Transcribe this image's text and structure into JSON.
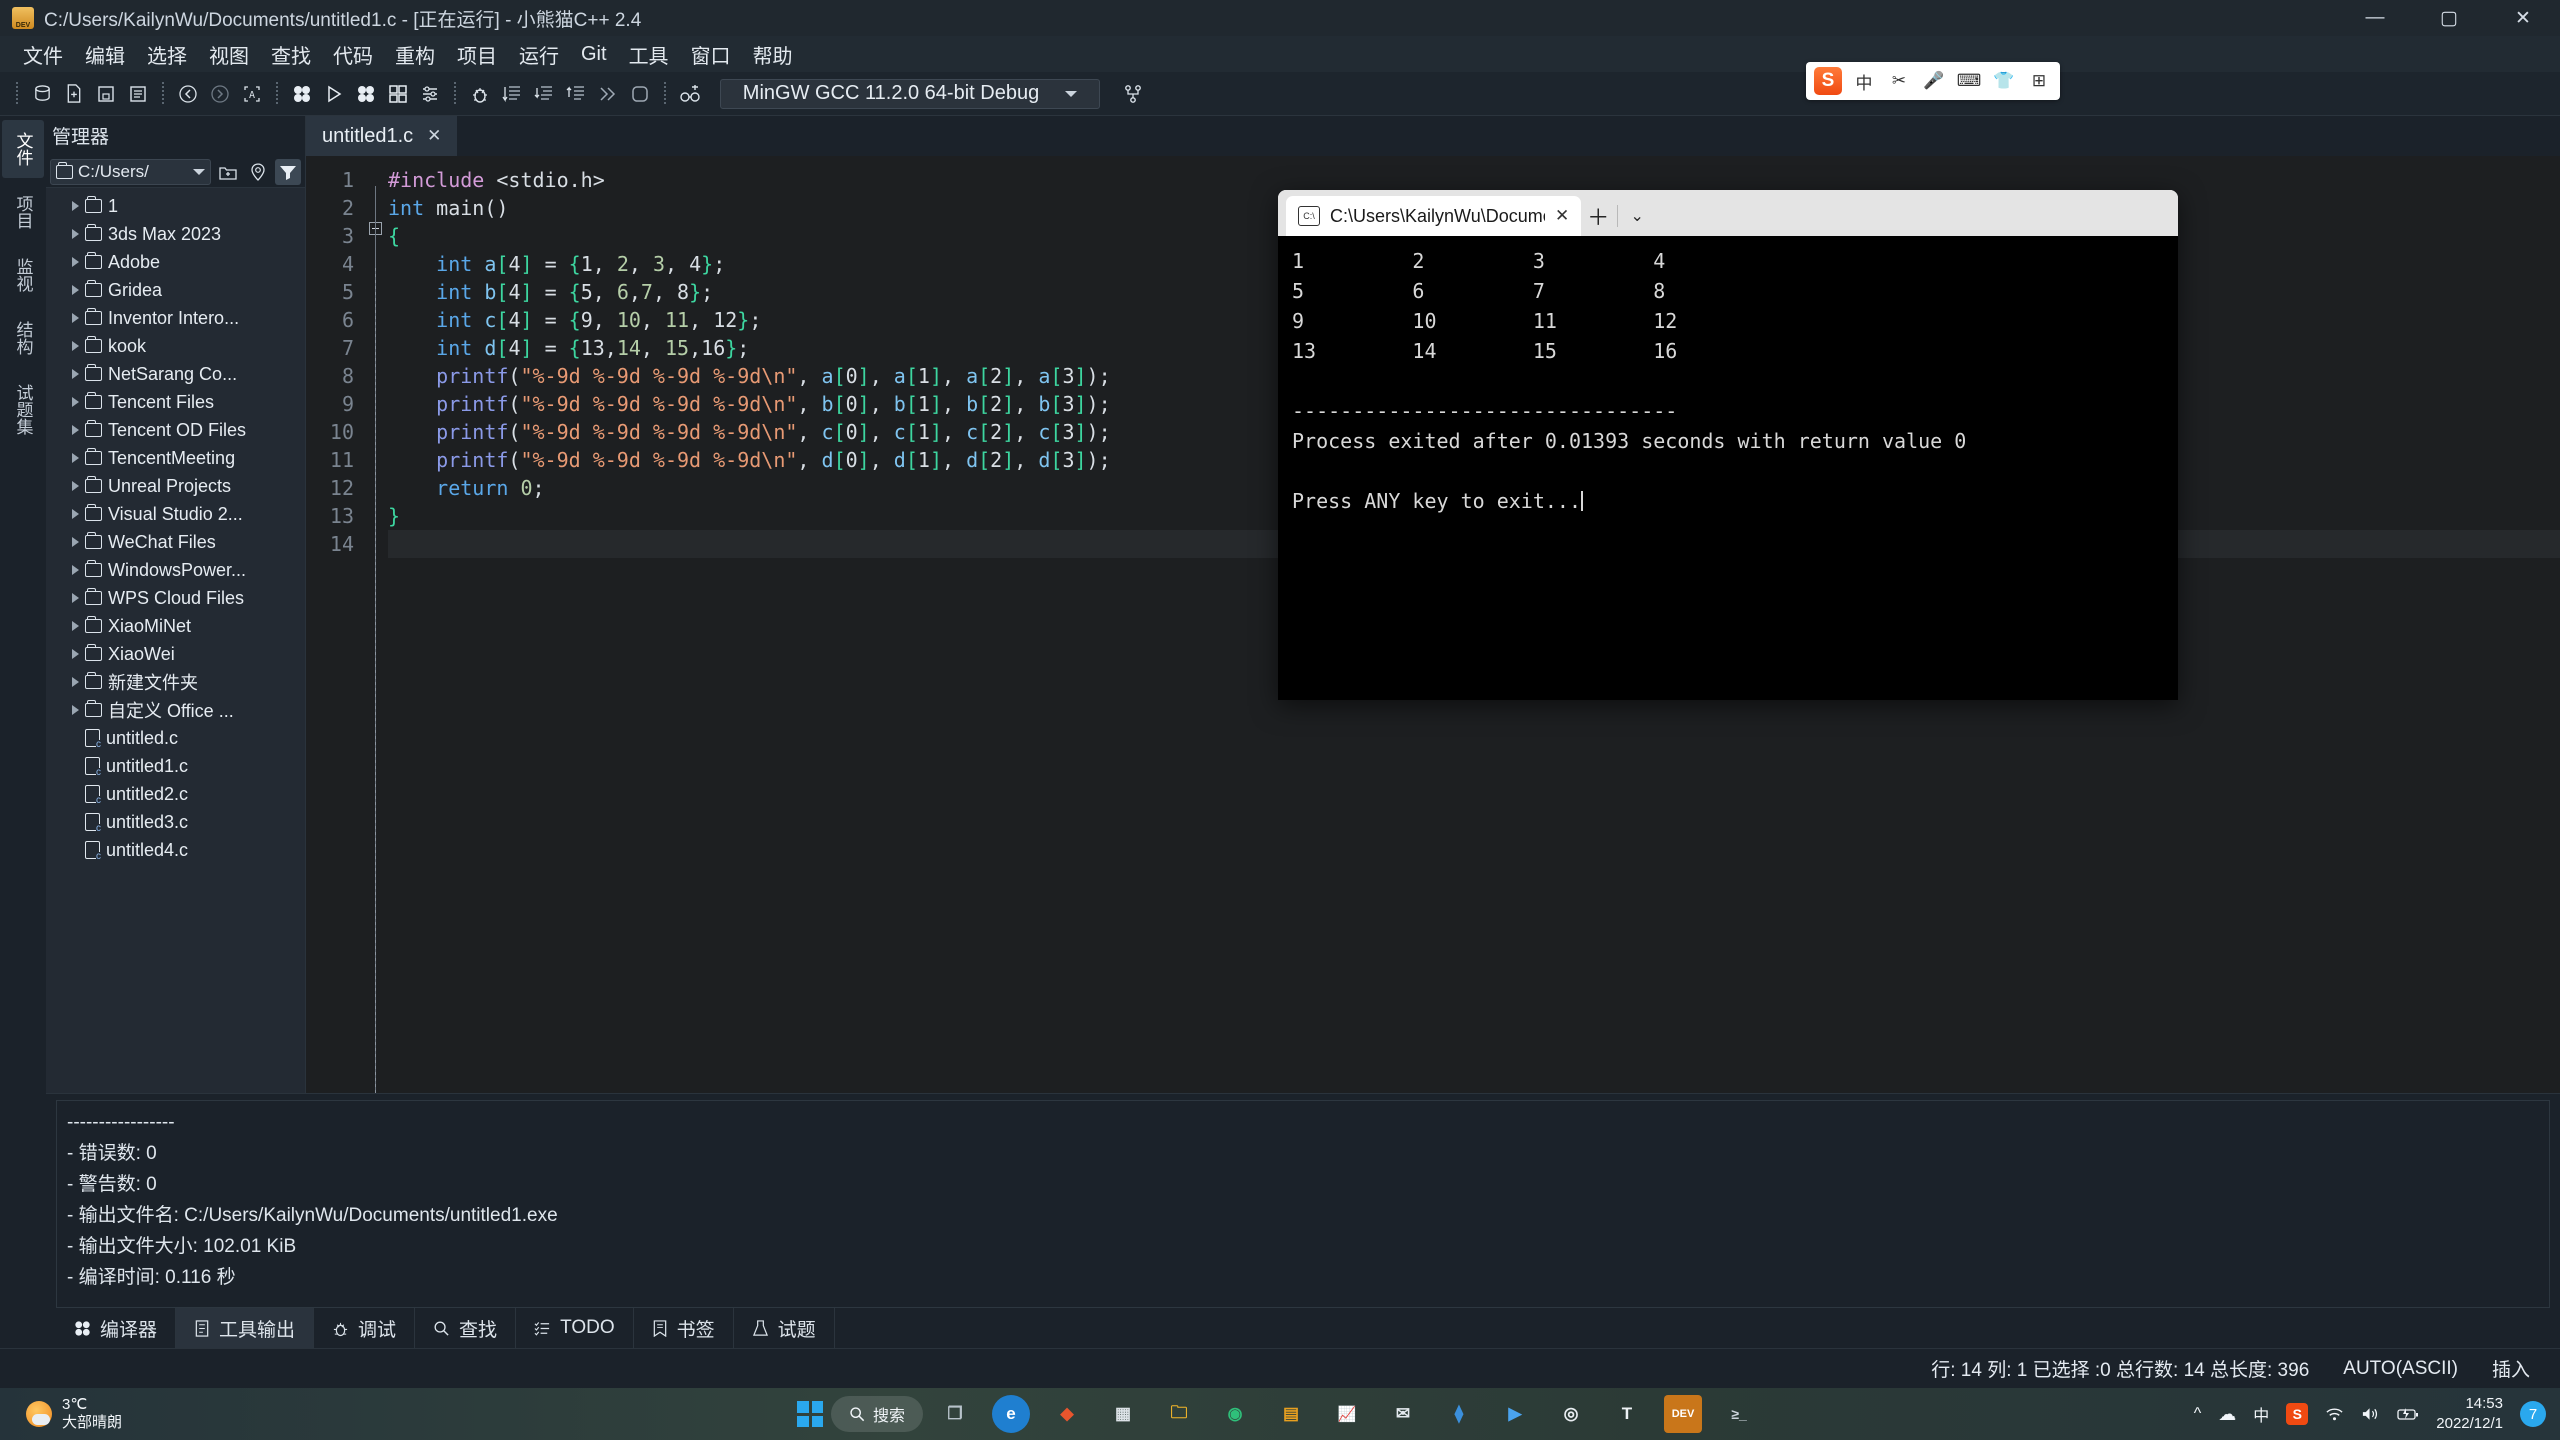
{
  "window": {
    "title": "C:/Users/KailynWu/Documents/untitled1.c - [正在运行] - 小熊猫C++ 2.4",
    "app_icon": "dev-cpp-icon",
    "minimize": "—",
    "maximize": "▢",
    "close": "✕"
  },
  "menubar": {
    "items": [
      "文件",
      "编辑",
      "选择",
      "视图",
      "查找",
      "代码",
      "重构",
      "项目",
      "运行",
      "Git",
      "工具",
      "窗口",
      "帮助"
    ]
  },
  "toolbar": {
    "buttons": [
      {
        "name": "new-project-icon",
        "glyph": "🗄"
      },
      {
        "name": "new-file-icon",
        "glyph": "＋"
      },
      {
        "name": "save-icon",
        "glyph": "💾"
      },
      {
        "name": "save-all-icon",
        "glyph": "🖫"
      },
      {
        "name": "back-icon",
        "glyph": "←"
      },
      {
        "name": "forward-icon",
        "glyph": "→"
      },
      {
        "name": "select-all-icon",
        "glyph": "A"
      },
      {
        "name": "compile-icon",
        "glyph": "✥"
      },
      {
        "name": "run-icon",
        "glyph": "▶"
      },
      {
        "name": "compile-run-icon",
        "glyph": "✤"
      },
      {
        "name": "rebuild-icon",
        "glyph": "⊞"
      },
      {
        "name": "options-icon",
        "glyph": "⚙"
      },
      {
        "name": "debug-icon",
        "glyph": "🐞"
      },
      {
        "name": "step-over-icon",
        "glyph": "⇥"
      },
      {
        "name": "step-into-icon",
        "glyph": "⇤"
      },
      {
        "name": "step-out-icon",
        "glyph": "⇲"
      },
      {
        "name": "continue-icon",
        "glyph": "⏩"
      },
      {
        "name": "stop-icon",
        "glyph": "◻"
      },
      {
        "name": "add-watch-icon",
        "glyph": "👓"
      }
    ],
    "compiler_set": "MinGW GCC 11.2.0 64-bit Debug",
    "compiler_options_icon": "branch-icon"
  },
  "ime": {
    "logo": "S",
    "mode": "中",
    "items": [
      "✂",
      "🎤",
      "⌨",
      "👕",
      "⊞"
    ]
  },
  "left_rail": {
    "tabs": [
      {
        "label": "文件",
        "icon": "files-icon",
        "active": true
      },
      {
        "label": "项目",
        "icon": "project-icon",
        "active": false
      },
      {
        "label": "监视",
        "icon": "watch-icon",
        "active": false
      },
      {
        "label": "结构",
        "icon": "structure-icon",
        "active": false
      },
      {
        "label": "试题集",
        "icon": "problemset-icon",
        "active": false
      }
    ]
  },
  "explorer": {
    "title": "管理器",
    "path": "C:/Users/",
    "path_dropdown_icon": "chevron-down-icon",
    "buttons": [
      {
        "name": "new-folder-icon",
        "glyph": "🗀"
      },
      {
        "name": "locate-icon",
        "glyph": "◎"
      },
      {
        "name": "filter-icon",
        "glyph": "▼",
        "active": true
      }
    ],
    "tree": [
      {
        "label": "1",
        "type": "folder"
      },
      {
        "label": "3ds Max 2023",
        "type": "folder"
      },
      {
        "label": "Adobe",
        "type": "folder"
      },
      {
        "label": "Gridea",
        "type": "folder"
      },
      {
        "label": "Inventor Intero...",
        "type": "folder"
      },
      {
        "label": "kook",
        "type": "folder"
      },
      {
        "label": "NetSarang Co...",
        "type": "folder"
      },
      {
        "label": "Tencent Files",
        "type": "folder"
      },
      {
        "label": "Tencent OD Files",
        "type": "folder"
      },
      {
        "label": "TencentMeeting",
        "type": "folder"
      },
      {
        "label": "Unreal Projects",
        "type": "folder"
      },
      {
        "label": "Visual Studio 2...",
        "type": "folder"
      },
      {
        "label": "WeChat Files",
        "type": "folder"
      },
      {
        "label": "WindowsPower...",
        "type": "folder"
      },
      {
        "label": "WPS Cloud Files",
        "type": "folder"
      },
      {
        "label": "XiaoMiNet",
        "type": "folder"
      },
      {
        "label": "XiaoWei",
        "type": "folder"
      },
      {
        "label": "新建文件夹",
        "type": "folder"
      },
      {
        "label": "自定义 Office ...",
        "type": "folder"
      },
      {
        "label": "untitled.c",
        "type": "file"
      },
      {
        "label": "untitled1.c",
        "type": "file"
      },
      {
        "label": "untitled2.c",
        "type": "file"
      },
      {
        "label": "untitled3.c",
        "type": "file"
      },
      {
        "label": "untitled4.c",
        "type": "file"
      }
    ]
  },
  "editor": {
    "tab": {
      "label": "untitled1.c",
      "close": "✕"
    },
    "line_numbers": [
      "1",
      "2",
      "3",
      "4",
      "5",
      "6",
      "7",
      "8",
      "9",
      "10",
      "11",
      "12",
      "13",
      "14"
    ],
    "lines": [
      "#include <stdio.h>",
      "int main()",
      "{",
      "    int a[4] = {1, 2, 3, 4};",
      "    int b[4] = {5, 6,7, 8};",
      "    int c[4] = {9, 10, 11, 12};",
      "    int d[4] = {13,14, 15,16};",
      "    printf(\"%-9d %-9d %-9d %-9d\\n\", a[0], a[1], a[2], a[3]);",
      "    printf(\"%-9d %-9d %-9d %-9d\\n\", b[0], b[1], b[2], b[3]);",
      "    printf(\"%-9d %-9d %-9d %-9d\\n\", c[0], c[1], c[2], c[3]);",
      "    printf(\"%-9d %-9d %-9d %-9d\\n\", d[0], d[1], d[2], d[3]);",
      "    return 0;",
      "}",
      ""
    ]
  },
  "tool_output": {
    "lines": [
      "-----------------",
      "- 错误数: 0",
      "- 警告数: 0",
      "- 输出文件名: C:/Users/KailynWu/Documents/untitled1.exe",
      "- 输出文件大小: 102.01 KiB",
      "- 编译时间: 0.116 秒"
    ]
  },
  "panel_tabs": [
    {
      "label": "编译器",
      "icon": "compiler-icon",
      "active": false
    },
    {
      "label": "工具输出",
      "icon": "tool-output-icon",
      "active": true
    },
    {
      "label": "调试",
      "icon": "debug-icon",
      "active": false
    },
    {
      "label": "查找",
      "icon": "search-icon",
      "active": false
    },
    {
      "label": "TODO",
      "icon": "todo-icon",
      "active": false
    },
    {
      "label": "书签",
      "icon": "bookmark-icon",
      "active": false
    },
    {
      "label": "试题",
      "icon": "problem-icon",
      "active": false
    }
  ],
  "statusbar": {
    "rail_label": "题集",
    "position": "行: 14 列: 1 已选择 :0 总行数: 14 总长度: 396",
    "encoding": "AUTO(ASCII)",
    "insert_mode": "插入"
  },
  "console": {
    "tab_icon": "cmd-icon",
    "tab_label": "C:\\Users\\KailynWu\\Document",
    "tab_close": "✕",
    "new_tab": "＋",
    "dropdown": "⌄",
    "output_rows": [
      [
        "1",
        "2",
        "3",
        "4"
      ],
      [
        "5",
        "6",
        "7",
        "8"
      ],
      [
        "9",
        "10",
        "11",
        "12"
      ],
      [
        "13",
        "14",
        "15",
        "16"
      ]
    ],
    "separator": "--------------------------------",
    "exit_message": "Process exited after 0.01393 seconds with return value 0",
    "prompt": "Press ANY key to exit..."
  },
  "taskbar": {
    "weather_temp": "3℃",
    "weather_desc": "大部晴朗",
    "search_label": "搜索",
    "search_icon": "search-icon",
    "start_icon": "windows-logo-icon",
    "apps": [
      {
        "name": "task-view-icon",
        "glyph": "❐",
        "color": "#6d7d86"
      },
      {
        "name": "edge-icon",
        "glyph": "e",
        "color": "#2a7fd4"
      },
      {
        "name": "chrome-alt-icon",
        "glyph": "◆",
        "color": "#e8552d"
      },
      {
        "name": "store-icon",
        "glyph": "▦",
        "color": "#d8dde2"
      },
      {
        "name": "explorer-icon",
        "glyph": "🗀",
        "color": "#f0b429"
      },
      {
        "name": "browser-icon",
        "glyph": "◉",
        "color": "#22bb66"
      },
      {
        "name": "office-icon",
        "glyph": "▤",
        "color": "#e8a020"
      },
      {
        "name": "chart-icon",
        "glyph": "📈",
        "color": "#5a7f9a"
      },
      {
        "name": "mail-icon",
        "glyph": "✉",
        "color": "#dfe5ea"
      },
      {
        "name": "vscode-icon",
        "glyph": "⧫",
        "color": "#2f7fd0"
      },
      {
        "name": "pinwheel-icon",
        "glyph": "▶",
        "color": "#4aa3ee"
      },
      {
        "name": "chrome-icon",
        "glyph": "◎",
        "color": "#e9eef2"
      },
      {
        "name": "typora-icon",
        "glyph": "T",
        "color": "#e9eef2"
      },
      {
        "name": "devcpp-icon",
        "glyph": "DEV",
        "color": "#d88a1e"
      },
      {
        "name": "terminal-icon",
        "glyph": "≥_",
        "color": "#cdd5dc"
      }
    ],
    "tray": [
      {
        "name": "show-hidden-icons",
        "glyph": "^"
      },
      {
        "name": "onedrive-icon",
        "glyph": "☁"
      },
      {
        "name": "ime-chinese-icon",
        "glyph": "中"
      },
      {
        "name": "sogou-icon",
        "glyph": "S"
      },
      {
        "name": "wifi-icon",
        "glyph": "wifi"
      },
      {
        "name": "volume-icon",
        "glyph": "🔊"
      },
      {
        "name": "battery-icon",
        "glyph": "🔋"
      }
    ],
    "time": "14:53",
    "date": "2022/12/1",
    "notification_count": "7"
  }
}
